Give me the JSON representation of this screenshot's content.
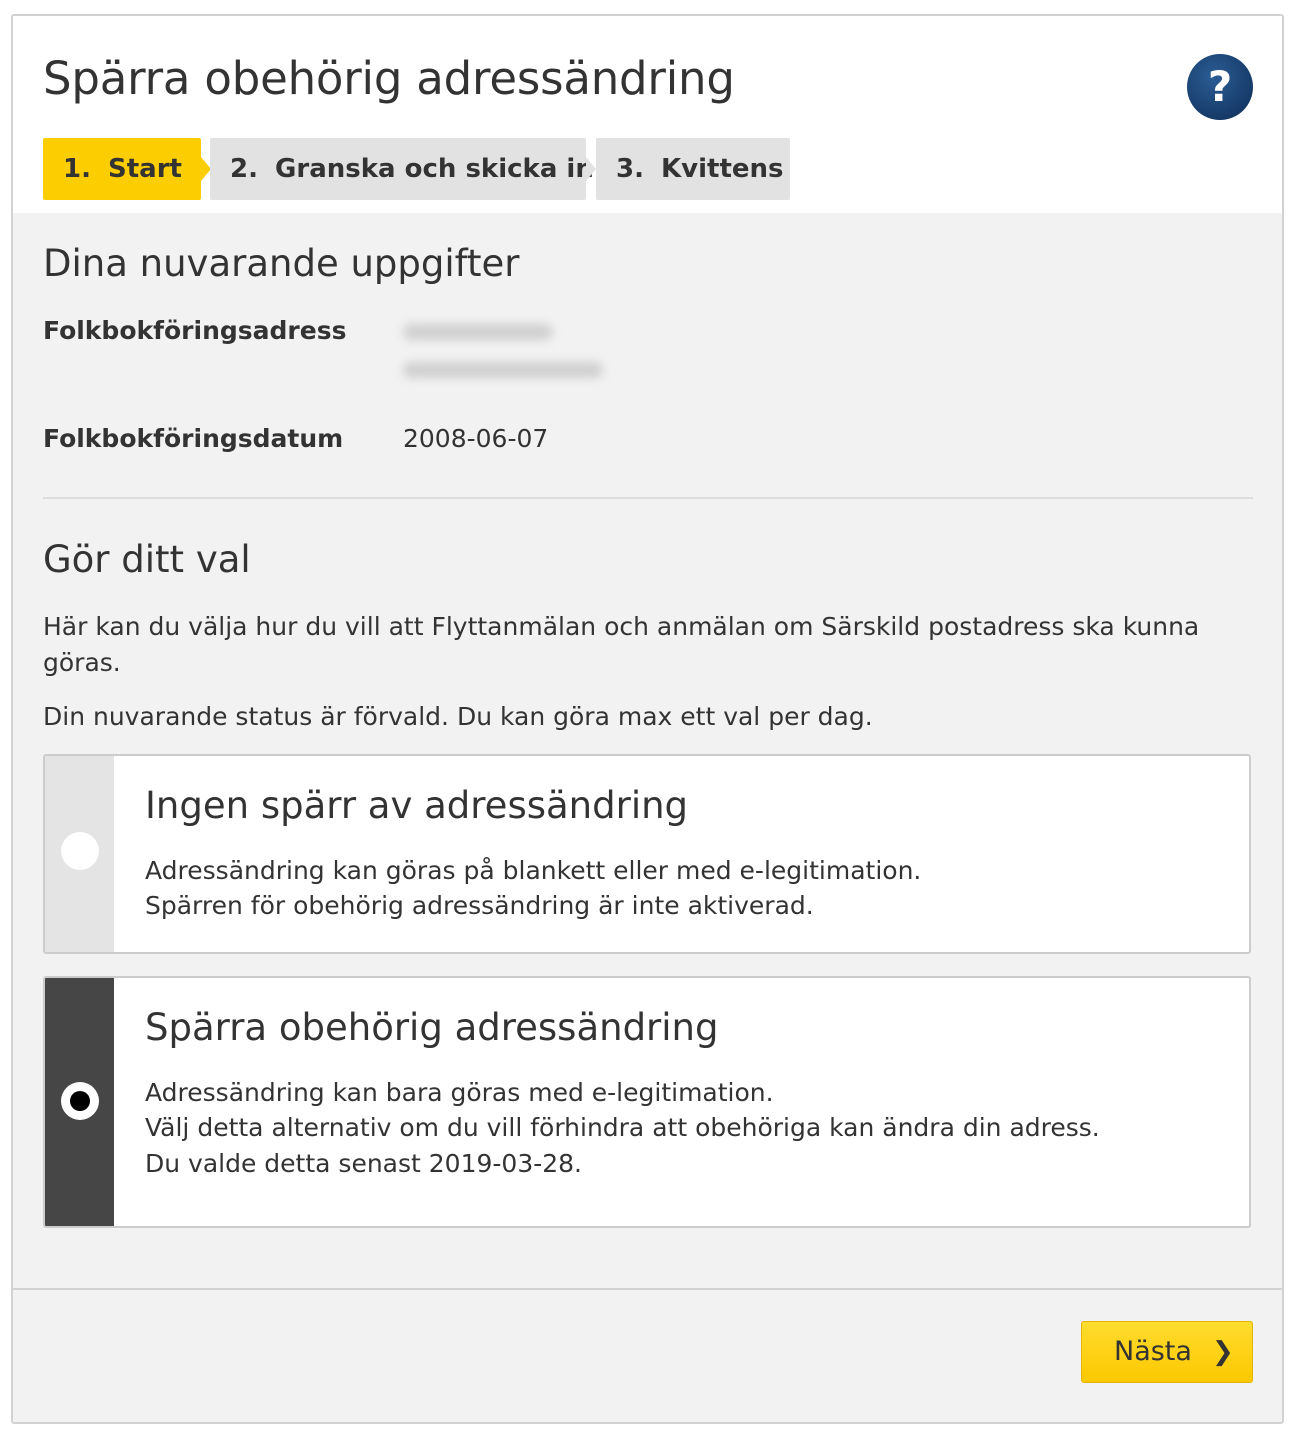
{
  "header": {
    "title": "Spärra obehörig adressändring",
    "help_label": "?"
  },
  "steps": [
    {
      "num": "1.",
      "label": "Start",
      "active": true
    },
    {
      "num": "2.",
      "label": "Granska och skicka in",
      "active": false
    },
    {
      "num": "3.",
      "label": "Kvittens",
      "active": false
    }
  ],
  "current": {
    "title": "Dina nuvarande uppgifter",
    "address_label": "Folkbokföringsadress",
    "date_label": "Folkbokföringsdatum",
    "date_value": "2008-06-07"
  },
  "choice": {
    "title": "Gör ditt val",
    "intro": "Här kan du välja hur du vill att Flyttanmälan och anmälan om Särskild postadress ska kunna göras.",
    "status_note": "Din nuvarande status är förvald. Du kan göra max ett val per dag.",
    "options": [
      {
        "title": "Ingen spärr av adressändring",
        "lines": [
          "Adressändring kan göras på blankett eller med e-legitimation.",
          "Spärren för obehörig adressändring är inte aktiverad."
        ],
        "selected": false
      },
      {
        "title": "Spärra obehörig adressändring",
        "lines": [
          "Adressändring kan bara göras med e-legitimation.",
          "Välj detta alternativ om du vill förhindra att obehöriga kan ändra din adress.",
          "Du valde detta senast 2019-03-28."
        ],
        "selected": true
      }
    ]
  },
  "footer": {
    "next_label": "Nästa",
    "next_icon": "chevron-right-icon"
  },
  "colors": {
    "accent_yellow": "#fccd00",
    "step_inactive": "#e2e2e2",
    "help_blue": "#173b69",
    "selected_rail": "#464646",
    "unselected_rail": "#e4e4e4"
  }
}
